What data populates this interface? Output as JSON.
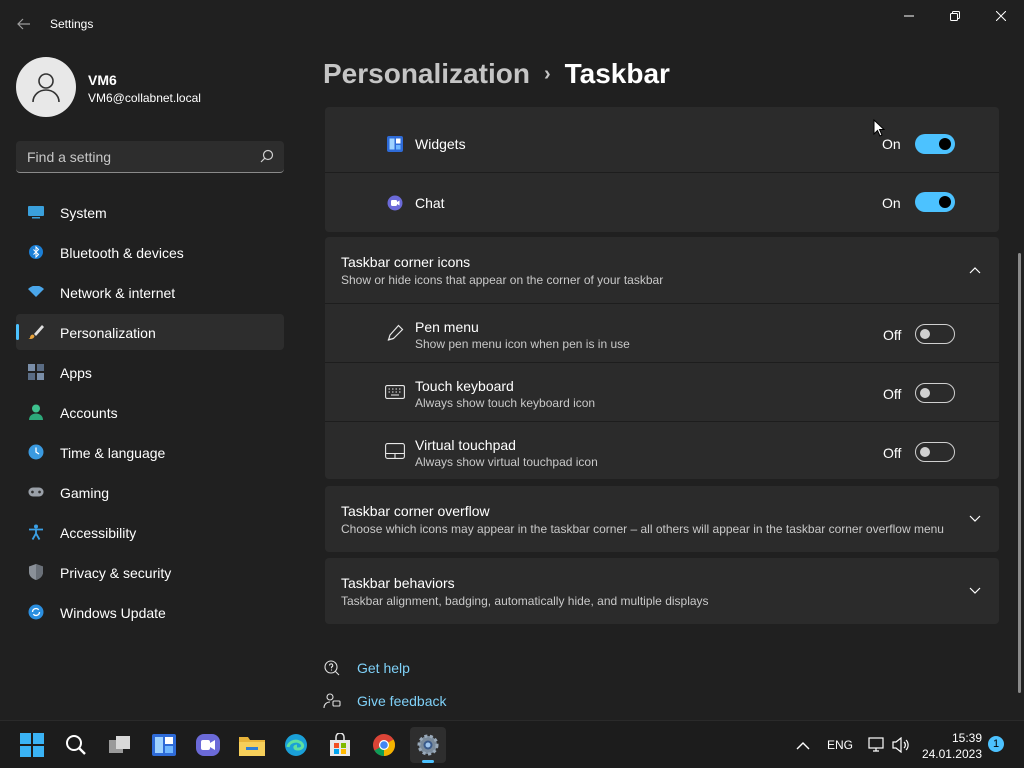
{
  "window": {
    "app_title": "Settings",
    "back_icon": "back-arrow-icon",
    "controls": [
      "minimize-icon",
      "restore-icon",
      "close-icon"
    ]
  },
  "profile": {
    "name": "VM6",
    "email": "VM6@collabnet.local"
  },
  "search": {
    "placeholder": "Find a setting"
  },
  "sidebar": {
    "items": [
      {
        "label": "System",
        "icon": "system-icon"
      },
      {
        "label": "Bluetooth & devices",
        "icon": "bluetooth-icon"
      },
      {
        "label": "Network & internet",
        "icon": "wifi-icon"
      },
      {
        "label": "Personalization",
        "icon": "brush-icon",
        "active": true
      },
      {
        "label": "Apps",
        "icon": "apps-icon"
      },
      {
        "label": "Accounts",
        "icon": "accounts-icon"
      },
      {
        "label": "Time & language",
        "icon": "clock-icon"
      },
      {
        "label": "Gaming",
        "icon": "gamepad-icon"
      },
      {
        "label": "Accessibility",
        "icon": "accessibility-icon"
      },
      {
        "label": "Privacy & security",
        "icon": "shield-icon"
      },
      {
        "label": "Windows Update",
        "icon": "update-icon"
      }
    ]
  },
  "breadcrumb": {
    "parent": "Personalization",
    "separator": "›",
    "current": "Taskbar"
  },
  "taskbar_items": {
    "widgets": {
      "label": "Widgets",
      "state": "On",
      "on": true
    },
    "chat": {
      "label": "Chat",
      "state": "On",
      "on": true
    }
  },
  "corner_icons": {
    "title": "Taskbar corner icons",
    "subtitle": "Show or hide icons that appear on the corner of your taskbar",
    "expanded": true,
    "items": {
      "pen": {
        "title": "Pen menu",
        "subtitle": "Show pen menu icon when pen is in use",
        "state": "Off",
        "on": false
      },
      "keyboard": {
        "title": "Touch keyboard",
        "subtitle": "Always show touch keyboard icon",
        "state": "Off",
        "on": false
      },
      "touchpad": {
        "title": "Virtual touchpad",
        "subtitle": "Always show virtual touchpad icon",
        "state": "Off",
        "on": false
      }
    }
  },
  "corner_overflow": {
    "title": "Taskbar corner overflow",
    "subtitle": "Choose which icons may appear in the taskbar corner – all others will appear in the taskbar corner overflow menu"
  },
  "behaviors": {
    "title": "Taskbar behaviors",
    "subtitle": "Taskbar alignment, badging, automatically hide, and multiple displays"
  },
  "help": {
    "get_help": "Get help",
    "give_feedback": "Give feedback"
  },
  "os_taskbar": {
    "apps": [
      "start-icon",
      "search-icon",
      "task-view-icon",
      "widgets-icon",
      "chat-icon",
      "file-explorer-icon",
      "edge-icon",
      "store-icon",
      "chrome-icon",
      "settings-icon"
    ],
    "active_app": "settings-icon",
    "language": "ENG",
    "time": "15:39",
    "date": "24.01.2023",
    "notifications": "1"
  },
  "colors": {
    "accent": "#4cc2ff",
    "background": "#202020",
    "card": "#2b2b2b",
    "link": "#7fd1f8"
  }
}
